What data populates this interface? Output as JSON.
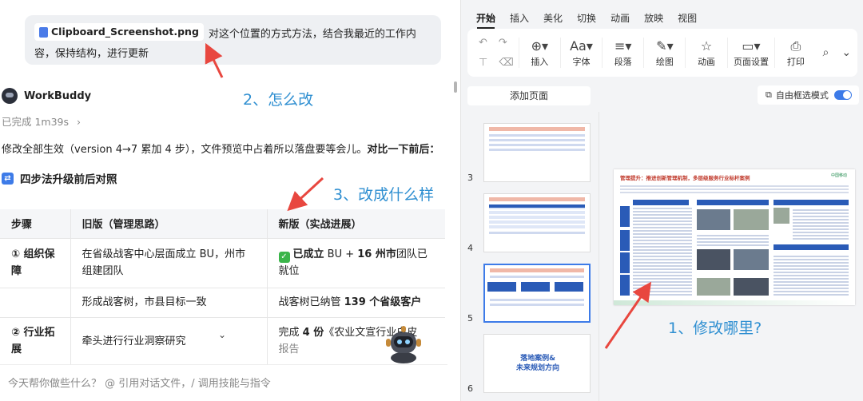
{
  "chat": {
    "user_message": {
      "file_name": "Clipboard_Screenshot.png",
      "text": "对这个位置的方式方法，结合我最近的工作内容，保持结构，进行更新"
    },
    "bot_name": "WorkBuddy",
    "status": "已完成 1m39s",
    "status_chevron": "›",
    "paragraph_main": "修改全部生效（version 4→7 累加 4 步），文件预览中占着所以落盘要等会儿。",
    "paragraph_bold": "对比一下前后：",
    "section_title": "四步法升级前后对照",
    "table": {
      "headers": [
        "步骤",
        "旧版（管理思路）",
        "新版（实战进展）"
      ],
      "rows": [
        {
          "step": "① 组织保障",
          "old": "在省级战客中心层面成立 BU，州市组建团队",
          "new_check": "✓",
          "new_bold1": "已成立",
          "new_mid": " BU + ",
          "new_bold2": "16 州市",
          "new_tail": "团队已就位"
        },
        {
          "step": "",
          "old": "形成战客树，市县目标一致",
          "new_pre": "战客树已纳管 ",
          "new_bold": "139 个省级客户"
        },
        {
          "step": "② 行业拓展",
          "old": "牵头进行行业洞察研究",
          "new_pre": "完成 ",
          "new_bold": "4 份",
          "new_tail": "《农业文宣行业白皮",
          "new_tail2": "报告"
        }
      ]
    },
    "input_placeholder": "今天帮你做些什么？ @ 引用对话文件，/ 调用技能与指令"
  },
  "annotations": {
    "a1": "1、修改哪里?",
    "a2": "2、怎么改",
    "a3": "3、改成什么样"
  },
  "ppt": {
    "tabs": [
      "开始",
      "插入",
      "美化",
      "切换",
      "动画",
      "放映",
      "视图"
    ],
    "toolbar": {
      "undo": "↶",
      "redo": "↷",
      "insert": "插入",
      "font": "字体",
      "paragraph": "段落",
      "draw": "绘图",
      "animation": "动画",
      "page_setup": "页面设置",
      "print": "打印"
    },
    "add_page": "添加页面",
    "free_select": "自由框选模式",
    "thumbnail_numbers": [
      "3",
      "4",
      "5",
      "6"
    ],
    "slide6_text": [
      "落地案例&",
      "未来规划方向"
    ],
    "slide": {
      "title": "管理提升：推进创新管理机制，多层级服务行业标杆案例",
      "logo_text": "中国移动"
    }
  },
  "colors": {
    "accent": "#3d7be8",
    "annotation": "#2f8fd1",
    "arrow": "#e8473f",
    "check": "#3bb54a"
  }
}
